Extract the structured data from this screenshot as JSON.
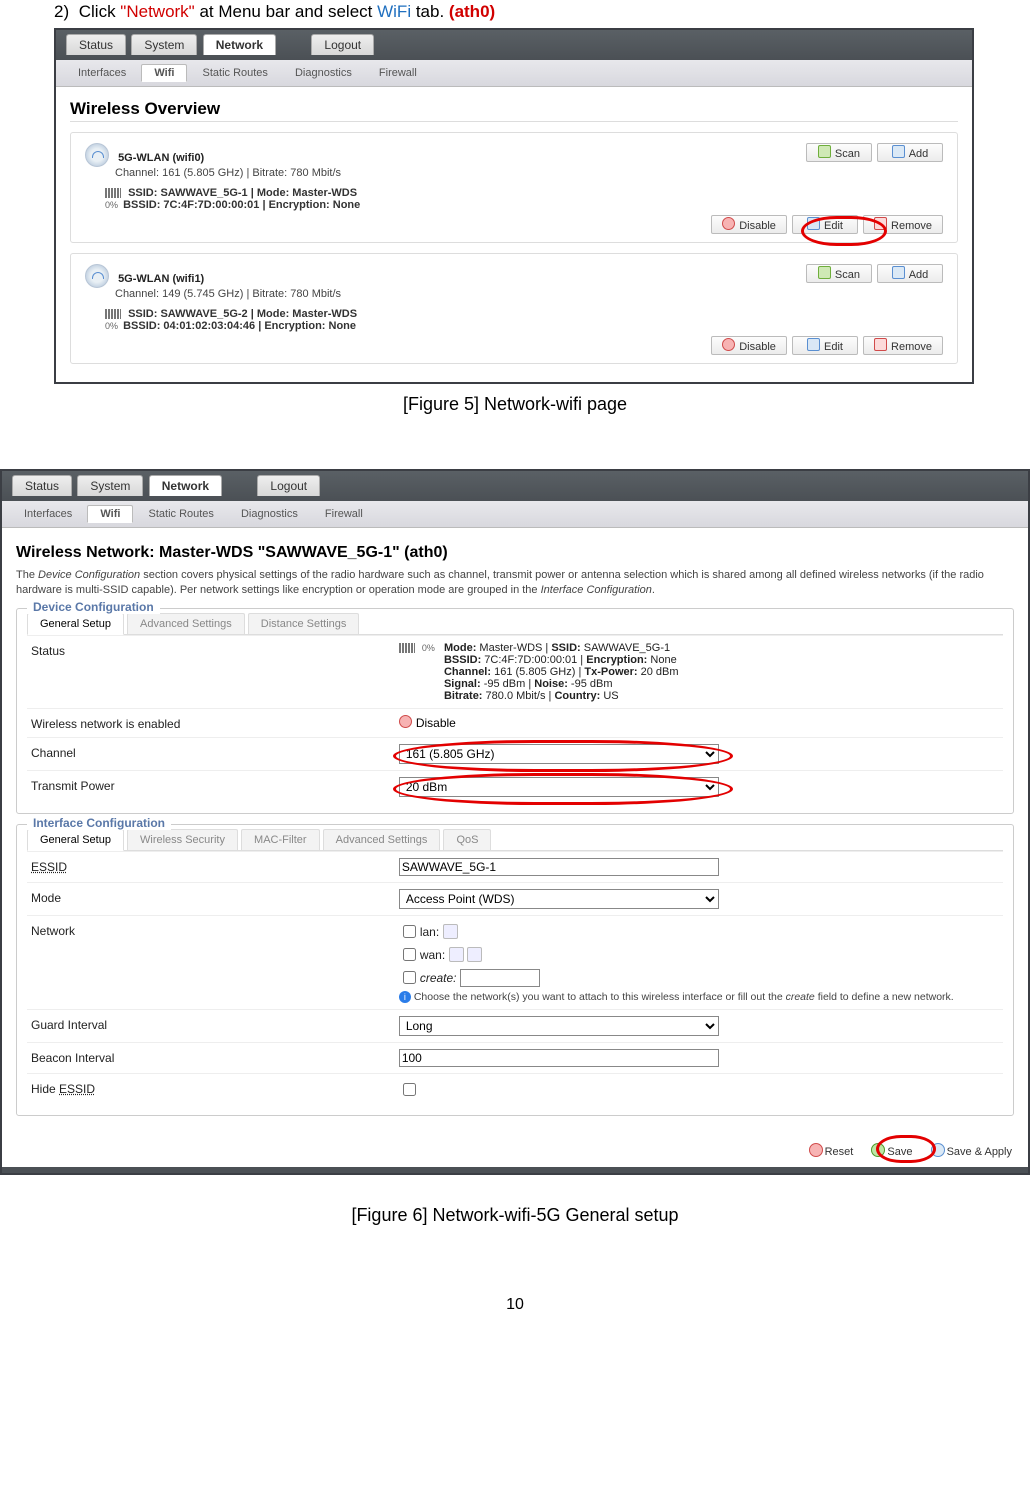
{
  "instruction": {
    "num": "2)",
    "t1": "Click ",
    "t2": "\"Network\"",
    "t3": " at Menu bar and select ",
    "t4": "WiFi",
    "t5": " tab. ",
    "t6": "(ath0)"
  },
  "menubar": {
    "tabs": [
      "Status",
      "System",
      "Network",
      "Logout"
    ],
    "activeIndex": 2
  },
  "subbar": {
    "tabs": [
      "Interfaces",
      "Wifi",
      "Static Routes",
      "Diagnostics",
      "Firewall"
    ],
    "activeIndex": 1
  },
  "fig5": {
    "title": "Wireless Overview",
    "cards": [
      {
        "name": "5G-WLAN (wifi0)",
        "chan": "Channel: 161 (5.805 GHz) | Bitrate: 780 Mbit/s",
        "pct": "0%",
        "line": "SSID: SAWWAVE_5G-1 | Mode: Master-WDS",
        "line2": "BSSID: 7C:4F:7D:00:00:01 | Encryption: None"
      },
      {
        "name": "5G-WLAN (wifi1)",
        "chan": "Channel: 149 (5.745 GHz) | Bitrate: 780 Mbit/s",
        "pct": "0%",
        "line": "SSID: SAWWAVE_5G-2 | Mode: Master-WDS",
        "line2": "BSSID: 04:01:02:03:04:46 | Encryption: None"
      }
    ],
    "btn": {
      "scan": "Scan",
      "add": "Add",
      "disable": "Disable",
      "edit": "Edit",
      "remove": "Remove"
    }
  },
  "caption5": "[Figure 5] Network-wifi page",
  "fig6": {
    "title": "Wireless Network: Master-WDS \"SAWWAVE_5G-1\" (ath0)",
    "desc1": "The ",
    "desc2": "Device Configuration",
    "desc3": " section covers physical settings of the radio hardware such as channel, transmit power or antenna selection which is shared among all defined wireless networks (if the radio hardware is multi-SSID capable). Per network settings like encryption or operation mode are grouped in the ",
    "desc4": "Interface Configuration",
    "desc5": ".",
    "dev": {
      "legend": "Device Configuration",
      "tabs": [
        "General Setup",
        "Advanced Settings",
        "Distance Settings"
      ],
      "statusLabel": "Status",
      "pct": "0%",
      "l1a": "Mode:",
      "l1b": " Master-WDS | ",
      "l1c": "SSID:",
      "l1d": " SAWWAVE_5G-1",
      "l2a": "BSSID:",
      "l2b": " 7C:4F:7D:00:00:01 | ",
      "l2c": "Encryption:",
      "l2d": " None",
      "l3a": "Channel:",
      "l3b": " 161 (5.805 GHz) | ",
      "l3c": "Tx-Power:",
      "l3d": " 20 dBm",
      "l4a": "Signal:",
      "l4b": " -95 dBm | ",
      "l4c": "Noise:",
      "l4d": " -95 dBm",
      "l5a": "Bitrate:",
      "l5b": " 780.0 Mbit/s | ",
      "l5c": "Country:",
      "l5d": " US",
      "enableLabel": "Wireless network is enabled",
      "disableBtn": "Disable",
      "chanLabel": "Channel",
      "chanVal": "161 (5.805 GHz)",
      "txLabel": "Transmit Power",
      "txVal": "20 dBm"
    },
    "iface": {
      "legend": "Interface Configuration",
      "tabs": [
        "General Setup",
        "Wireless Security",
        "MAC-Filter",
        "Advanced Settings",
        "QoS"
      ],
      "essidLabel": "ESSID",
      "essidVal": "SAWWAVE_5G-1",
      "modeLabel": "Mode",
      "modeVal": "Access Point (WDS)",
      "netLabel": "Network",
      "lan": "lan:",
      "wan": "wan:",
      "create": "create:",
      "help": "Choose the network(s) you want to attach to this wireless interface or fill out the ",
      "helpi": "create",
      "help2": " field to define a new network.",
      "giLabel": "Guard Interval",
      "giVal": "Long",
      "biLabel": "Beacon Interval",
      "biVal": "100",
      "hideLabel": "Hide ESSID"
    },
    "actions": {
      "reset": "Reset",
      "save": "Save",
      "apply": "Save & Apply"
    }
  },
  "caption6": "[Figure 6] Network-wifi-5G General setup",
  "pageNo": "10"
}
